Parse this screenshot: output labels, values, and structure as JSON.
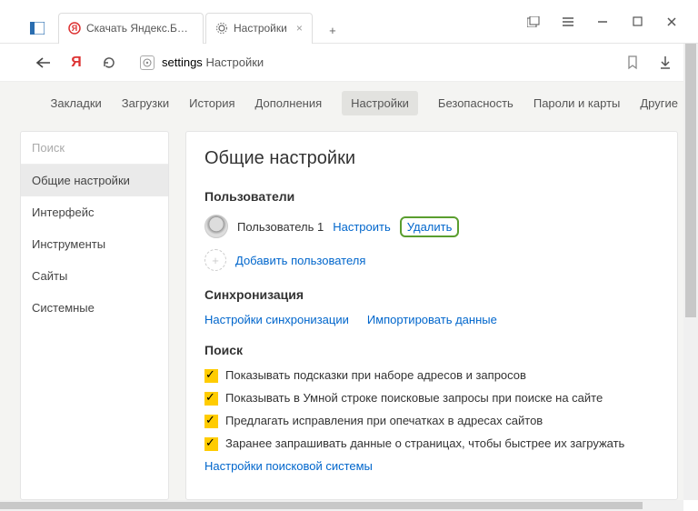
{
  "tabs": [
    {
      "title": "Скачать Яндекс.Браузер д..."
    },
    {
      "title": "Настройки"
    }
  ],
  "addr": {
    "host": "settings",
    "path": "Настройки"
  },
  "nav": {
    "items": [
      "Закладки",
      "Загрузки",
      "История",
      "Дополнения",
      "Настройки",
      "Безопасность",
      "Пароли и карты",
      "Другие"
    ],
    "activeIndex": 4
  },
  "sidebar": {
    "search_placeholder": "Поиск",
    "items": [
      "Общие настройки",
      "Интерфейс",
      "Инструменты",
      "Сайты",
      "Системные"
    ],
    "activeIndex": 0
  },
  "main": {
    "title": "Общие настройки",
    "users": {
      "heading": "Пользователи",
      "user_name": "Пользователь 1",
      "configure": "Настроить",
      "delete": "Удалить",
      "add": "Добавить пользователя"
    },
    "sync": {
      "heading": "Синхронизация",
      "settings_link": "Настройки синхронизации",
      "import_link": "Импортировать данные"
    },
    "search": {
      "heading": "Поиск",
      "opts": [
        "Показывать подсказки при наборе адресов и запросов",
        "Показывать в Умной строке поисковые запросы при поиске на сайте",
        "Предлагать исправления при опечатках в адресах сайтов",
        "Заранее запрашивать данные о страницах, чтобы быстрее их загружать"
      ],
      "engine_link": "Настройки поисковой системы"
    }
  }
}
